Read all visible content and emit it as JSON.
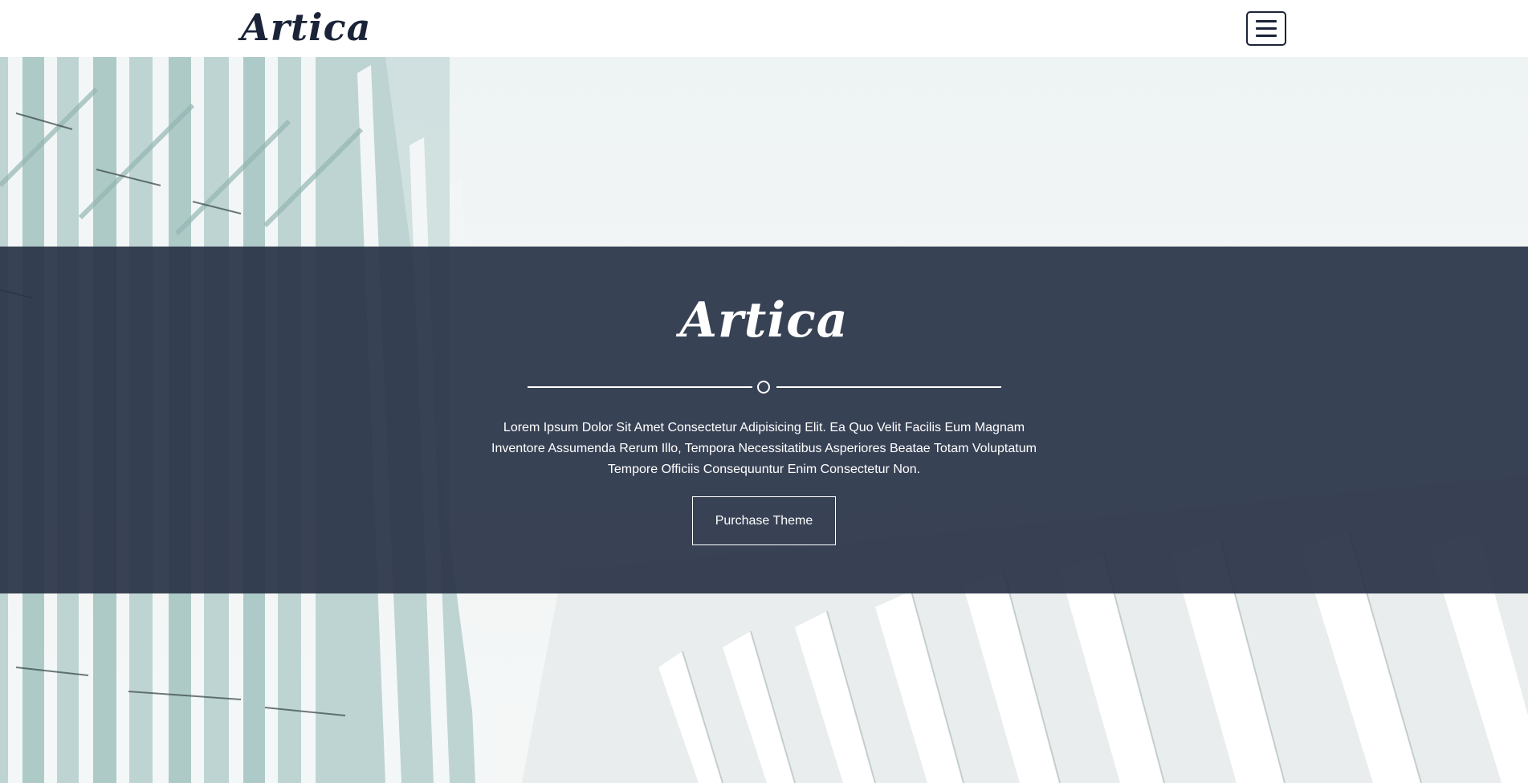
{
  "header": {
    "brand": "Artica",
    "menu_icon": "hamburger-menu-icon"
  },
  "hero": {
    "title": "Artica",
    "divider_icon": "circle-divider-icon",
    "description": "Lorem Ipsum Dolor Sit Amet Consectetur Adipisicing Elit. Ea Quo Velit Facilis Eum Magnam Inventore Assumenda Rerum Illo, Tempora Necessitatibus Asperiores Beatae Totam Voluptatum Tempore Officiis Consequuntur Enim Consectetur Non.",
    "button_label": "Purchase Theme"
  },
  "colors": {
    "brand_navy": "#1b2338",
    "band_overlay": "#283246",
    "text_light": "#ffffff"
  }
}
